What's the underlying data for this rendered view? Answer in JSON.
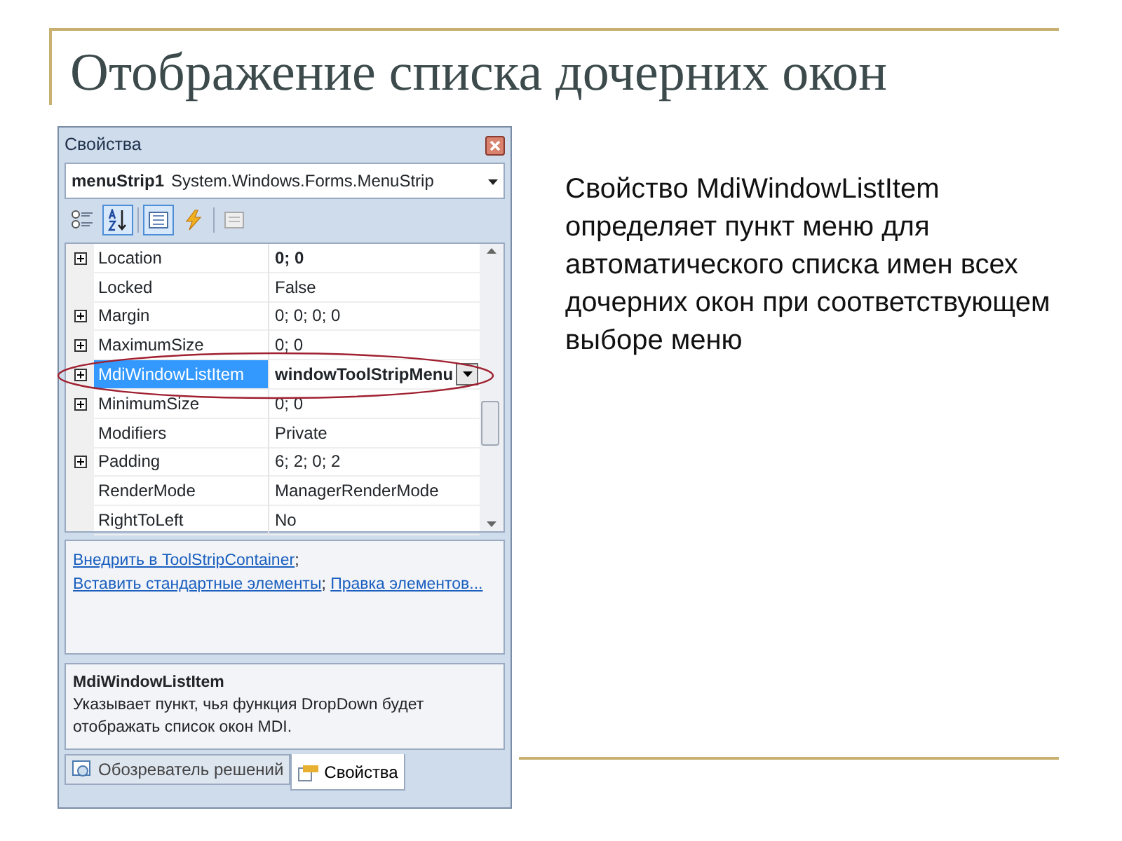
{
  "slide_title": "Отображение списка дочерних окон",
  "properties_window": {
    "title": "Свойства",
    "object_name": "menuStrip1",
    "object_type": "System.Windows.Forms.MenuStrip",
    "toolbar": [
      {
        "kind": "categorized",
        "selected": false
      },
      {
        "kind": "alphabetical",
        "selected": true
      },
      {
        "kind": "separator"
      },
      {
        "kind": "properties",
        "selected": true
      },
      {
        "kind": "events",
        "selected": false
      },
      {
        "kind": "separator"
      },
      {
        "kind": "pages",
        "selected": false
      }
    ],
    "rows": [
      {
        "name": "Location",
        "value": "0; 0",
        "expandable": true,
        "bold": true,
        "selected": false,
        "annotated": false
      },
      {
        "name": "Locked",
        "value": "False",
        "expandable": false,
        "bold": false,
        "selected": false,
        "annotated": false
      },
      {
        "name": "Margin",
        "value": "0; 0; 0; 0",
        "expandable": true,
        "bold": false,
        "selected": false,
        "annotated": false
      },
      {
        "name": "MaximumSize",
        "value": "0; 0",
        "expandable": true,
        "bold": false,
        "selected": false,
        "annotated": false
      },
      {
        "name": "MdiWindowListItem",
        "value": "windowToolStripMenu",
        "expandable": true,
        "bold": true,
        "selected": true,
        "annotated": true
      },
      {
        "name": "MinimumSize",
        "value": "0; 0",
        "expandable": true,
        "bold": false,
        "selected": false,
        "annotated": false
      },
      {
        "name": "Modifiers",
        "value": "Private",
        "expandable": false,
        "bold": false,
        "selected": false,
        "annotated": false
      },
      {
        "name": "Padding",
        "value": "6; 2; 0; 2",
        "expandable": true,
        "bold": false,
        "selected": false,
        "annotated": false
      },
      {
        "name": "RenderMode",
        "value": "ManagerRenderMode",
        "expandable": false,
        "bold": false,
        "selected": false,
        "annotated": false
      },
      {
        "name": "RightToLeft",
        "value": "No",
        "expandable": false,
        "bold": false,
        "selected": false,
        "annotated": false
      }
    ],
    "commands": [
      {
        "kind": "link",
        "text": "Внедрить в ToolStripContainer"
      },
      {
        "kind": "text",
        "text": "; "
      },
      {
        "kind": "link",
        "text": "Вставить стандартные элементы"
      },
      {
        "kind": "text",
        "text": "; "
      },
      {
        "kind": "link",
        "text": "Правка элементов..."
      }
    ],
    "description": {
      "title": "MdiWindowListItem",
      "text": "Указывает пункт, чья функция DropDown будет отображать список окон MDI."
    },
    "tabs": [
      {
        "label": "Обозреватель решений",
        "selected": false
      },
      {
        "label": "Свойства",
        "selected": true
      }
    ]
  },
  "body_text": "Свойство MdiWindowListItem определяет пункт меню для автоматического списка имен всех дочерних окон при соответствующем выборе меню"
}
